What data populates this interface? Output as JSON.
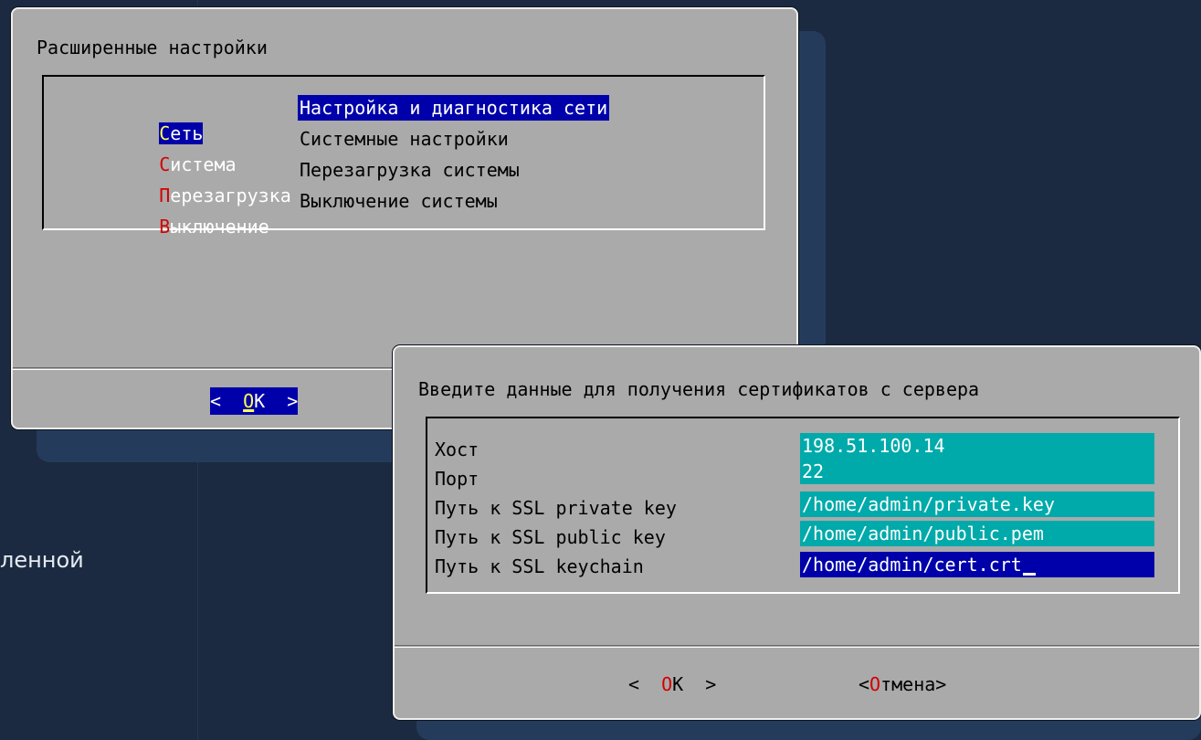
{
  "background": {
    "partial_text": "ленной"
  },
  "dialog1": {
    "title": "Расширенные настройки",
    "menu": [
      {
        "hotkey": "С",
        "rest": "еть",
        "description": "Настройка и диагностика сети",
        "selected": true
      },
      {
        "hotkey": "С",
        "rest": "истема",
        "description": "Системные настройки",
        "selected": false
      },
      {
        "hotkey": "П",
        "rest": "ерезагрузка",
        "description": "Перезагрузка системы",
        "selected": false
      },
      {
        "hotkey": "В",
        "rest": "ыключение",
        "description": "Выключение системы",
        "selected": false
      }
    ],
    "ok_button": {
      "left": "<  ",
      "hotkey": "O",
      "rest": "K  >"
    }
  },
  "dialog2": {
    "title": "Введите данные для получения сертификатов с сервера",
    "fields": [
      {
        "label": "Хост",
        "value": "198.51.100.14",
        "active": false
      },
      {
        "label": "Порт",
        "value": "22",
        "active": false
      },
      {
        "label": "Путь к SSL private key",
        "value": "/home/admin/private.key",
        "active": false
      },
      {
        "label": "Путь к SSL public key",
        "value": "/home/admin/public.pem",
        "active": false
      },
      {
        "label": "Путь к SSL keychain",
        "value": "/home/admin/cert.crt",
        "active": true
      }
    ],
    "ok_button": {
      "left": "<  ",
      "hotkey": "O",
      "rest": "K  >"
    },
    "cancel_button": {
      "left": "<",
      "hotkey": "О",
      "rest": "тмена>"
    }
  },
  "colors": {
    "background": "#1b2a40",
    "dialog": "#aaaaaa",
    "selection": "#0000aa",
    "input_field": "#00aaaa",
    "hotkey": "#d40000",
    "hotkey_selected": "#ffff55"
  }
}
